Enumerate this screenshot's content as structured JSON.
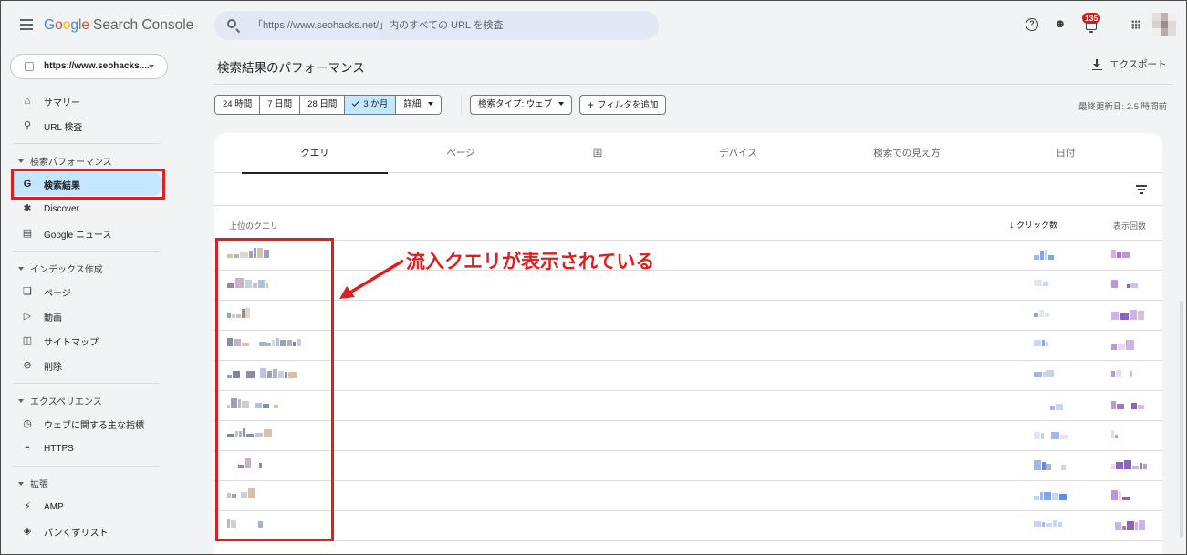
{
  "app": {
    "logo_google": [
      "G",
      "o",
      "o",
      "g",
      "l",
      "e"
    ],
    "logo_product": "Search Console",
    "search_placeholder": "「https://www.seohacks.net/」内のすべての URL を検査",
    "notification_count": "135"
  },
  "property": {
    "label": "https://www.seohacks...."
  },
  "sidebar": {
    "top_items": [
      {
        "label": "サマリー",
        "icon": "home-icon"
      },
      {
        "label": "URL 検査",
        "icon": "search-icon"
      }
    ],
    "sections": [
      {
        "title": "検索パフォーマンス",
        "items": [
          {
            "label": "検索結果",
            "icon": "google-g-icon",
            "active": true
          },
          {
            "label": "Discover",
            "icon": "asterisk-icon"
          },
          {
            "label": "Google ニュース",
            "icon": "news-icon"
          }
        ]
      },
      {
        "title": "インデックス作成",
        "items": [
          {
            "label": "ページ",
            "icon": "pages-icon"
          },
          {
            "label": "動画",
            "icon": "video-icon"
          },
          {
            "label": "サイトマップ",
            "icon": "sitemap-icon"
          },
          {
            "label": "削除",
            "icon": "removal-icon"
          }
        ]
      },
      {
        "title": "エクスペリエンス",
        "items": [
          {
            "label": "ウェブに関する主な指標",
            "icon": "gauge-icon"
          },
          {
            "label": "HTTPS",
            "icon": "lock-icon"
          }
        ]
      },
      {
        "title": "拡張",
        "items": [
          {
            "label": "AMP",
            "icon": "bolt-icon"
          },
          {
            "label": "パンくずリスト",
            "icon": "layers-icon"
          }
        ]
      }
    ]
  },
  "header": {
    "title": "検索結果のパフォーマンス",
    "export_label": "エクスポート",
    "last_updated": "最終更新日: 2.5 時間前"
  },
  "filters": {
    "ranges": [
      {
        "label": "24 時間"
      },
      {
        "label": "7 日間"
      },
      {
        "label": "28 日間"
      },
      {
        "label": "3 か月",
        "selected": true
      },
      {
        "label": "詳細",
        "dropdown": true
      }
    ],
    "search_type": "検索タイプ: ウェブ",
    "add_filter": "フィルタを追加"
  },
  "tabs": [
    "クエリ",
    "ページ",
    "国",
    "デバイス",
    "検索での見え方",
    "日付"
  ],
  "table": {
    "header_query": "上位のクエリ",
    "header_clicks": "クリック数",
    "header_impressions": "表示回数",
    "row_count": 10
  },
  "annotation": {
    "text": "流入クエリが表示されている",
    "color": "#e01e1e"
  },
  "colors": {
    "accent": "#c2e7ff",
    "annotation": "#e01e1e"
  }
}
